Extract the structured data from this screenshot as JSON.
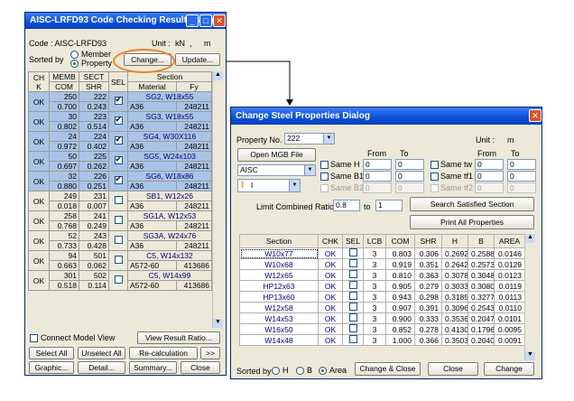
{
  "left_dialog": {
    "title": "AISC-LRFD93 Code Checking Result Dialog",
    "code_label": "Code : AISC-LRFD93",
    "unit_label": "Unit :",
    "unit_force": "kN",
    "unit_sep": ",",
    "unit_length": "m",
    "sorted_by_label": "Sorted by",
    "sort_member": "Member",
    "sort_property": "Property",
    "change_button": "Change...",
    "update_button": "Update...",
    "headers": {
      "chk": "CH K",
      "memb": "MEMB",
      "com": "COM",
      "sect": "SECT",
      "shr": "SHR",
      "sel": "SEL",
      "section": "Section",
      "material": "Material",
      "fy": "Fy"
    },
    "rows": [
      {
        "chk": "OK",
        "memb": "250",
        "sect": "222",
        "com": "0.700",
        "shr": "0.243",
        "section": "SG2, W18x55",
        "material": "A36",
        "fy": "248211",
        "sel": true,
        "hl": true
      },
      {
        "chk": "OK",
        "memb": "30",
        "sect": "223",
        "com": "0.802",
        "shr": "0.514",
        "section": "SG3, W18x55",
        "material": "A36",
        "fy": "248211",
        "sel": true,
        "hl": true
      },
      {
        "chk": "OK",
        "memb": "24",
        "sect": "224",
        "com": "0.972",
        "shr": "0.402",
        "section": "SG4, W30X116",
        "material": "A36",
        "fy": "248211",
        "sel": true,
        "hl": true
      },
      {
        "chk": "OK",
        "memb": "50",
        "sect": "225",
        "com": "0.697",
        "shr": "0.262",
        "section": "SG5, W24x103",
        "material": "A36",
        "fy": "248211",
        "sel": true,
        "hl": true
      },
      {
        "chk": "OK",
        "memb": "32",
        "sect": "226",
        "com": "0.880",
        "shr": "0.251",
        "section": "SG6, W18x86",
        "material": "A36",
        "fy": "248211",
        "sel": true,
        "hl": true
      },
      {
        "chk": "OK",
        "memb": "249",
        "sect": "231",
        "com": "0.018",
        "shr": "0.007",
        "section": "SB1, W12x26",
        "material": "A36",
        "fy": "248211",
        "sel": false,
        "hl": false
      },
      {
        "chk": "OK",
        "memb": "258",
        "sect": "241",
        "com": "0.768",
        "shr": "0.249",
        "section": "SG1A, W12x53",
        "material": "A36",
        "fy": "248211",
        "sel": false,
        "hl": false
      },
      {
        "chk": "OK",
        "memb": "52",
        "sect": "243",
        "com": "0.733",
        "shr": "0.428",
        "section": "SG3A, W24x76",
        "material": "A36",
        "fy": "248211",
        "sel": false,
        "hl": false
      },
      {
        "chk": "OK",
        "memb": "94",
        "sect": "501",
        "com": "0.663",
        "shr": "0.062",
        "section": "C5, W14x132",
        "material": "A572-60",
        "fy": "413686",
        "sel": false,
        "hl": false
      },
      {
        "chk": "OK",
        "memb": "301",
        "sect": "502",
        "com": "0.518",
        "shr": "0.114",
        "section": "C5, W14x99",
        "material": "A572-60",
        "fy": "413686",
        "sel": false,
        "hl": false
      }
    ],
    "connect_model_view": "Connect Model View",
    "view_result_ratio": "View Result Ratio...",
    "select_all": "Select All",
    "unselect_all": "Unselect All",
    "recalculation": "Re-calculation",
    "more": ">>",
    "graphic": "Graphic...",
    "detail": "Detail...",
    "summary": "Summary...",
    "close": "Close"
  },
  "right_dialog": {
    "title": "Change Steel Properties Dialog",
    "property_no_label": "Property No.",
    "property_no_value": "222",
    "unit_label": "Unit :",
    "unit_value": "m",
    "open_mgb_file": "Open MGB File",
    "from_label": "From",
    "to_label": "To",
    "same_h": "Same H",
    "same_b1": "Same B1",
    "same_b2": "Same B2",
    "same_tw": "Same tw",
    "same_tf1": "Same tf1",
    "same_tf2": "Same tf2",
    "zero": "0",
    "db_value": "AISC",
    "shape_value": "I",
    "limit_label": "Limit Combined Ratio from",
    "limit_from": "0.8",
    "limit_to_label": "to",
    "limit_to": "1",
    "search_button": "Search Satisfied Section",
    "print_button": "Print All Properties",
    "headers": {
      "section": "Section",
      "chk": "CHK",
      "sel": "SEL",
      "lcb": "LCB",
      "com": "COM",
      "shr": "SHR",
      "h": "H",
      "b": "B",
      "area": "AREA"
    },
    "rows": [
      {
        "section": "W10x77",
        "chk": "OK",
        "lcb": "3",
        "com": "0.803",
        "shr": "0.306",
        "h": "0.2692",
        "b": "0.2588",
        "area": "0.0146"
      },
      {
        "section": "W10x68",
        "chk": "OK",
        "lcb": "3",
        "com": "0.919",
        "shr": "0.351",
        "h": "0.2642",
        "b": "0.2573",
        "area": "0.0129"
      },
      {
        "section": "W12x65",
        "chk": "OK",
        "lcb": "3",
        "com": "0.810",
        "shr": "0.363",
        "h": "0.3078",
        "b": "0.3048",
        "area": "0.0123"
      },
      {
        "section": "HP12x63",
        "chk": "OK",
        "lcb": "3",
        "com": "0.905",
        "shr": "0.279",
        "h": "0.3033",
        "b": "0.3080",
        "area": "0.0119"
      },
      {
        "section": "HP13x60",
        "chk": "OK",
        "lcb": "3",
        "com": "0.943",
        "shr": "0.298",
        "h": "0.3185",
        "b": "0.3277",
        "area": "0.0113"
      },
      {
        "section": "W12x58",
        "chk": "OK",
        "lcb": "3",
        "com": "0.907",
        "shr": "0.391",
        "h": "0.3096",
        "b": "0.2543",
        "area": "0.0110"
      },
      {
        "section": "W14x53",
        "chk": "OK",
        "lcb": "3",
        "com": "0.900",
        "shr": "0.333",
        "h": "0.3536",
        "b": "0.2047",
        "area": "0.0101"
      },
      {
        "section": "W16x50",
        "chk": "OK",
        "lcb": "3",
        "com": "0.852",
        "shr": "0.278",
        "h": "0.4130",
        "b": "0.1796",
        "area": "0.0095"
      },
      {
        "section": "W14x48",
        "chk": "OK",
        "lcb": "3",
        "com": "1.000",
        "shr": "0.366",
        "h": "0.3503",
        "b": "0.2040",
        "area": "0.0091"
      }
    ],
    "sorted_by_label": "Sorted by",
    "sort_h": "H",
    "sort_b": "B",
    "sort_area": "Area",
    "change_close": "Change & Close",
    "close": "Close",
    "change": "Change"
  },
  "colors": {
    "titlebar": "#0a4fd8",
    "selected_row": "#a9c4e6",
    "highlight_ring": "#e8822a"
  }
}
